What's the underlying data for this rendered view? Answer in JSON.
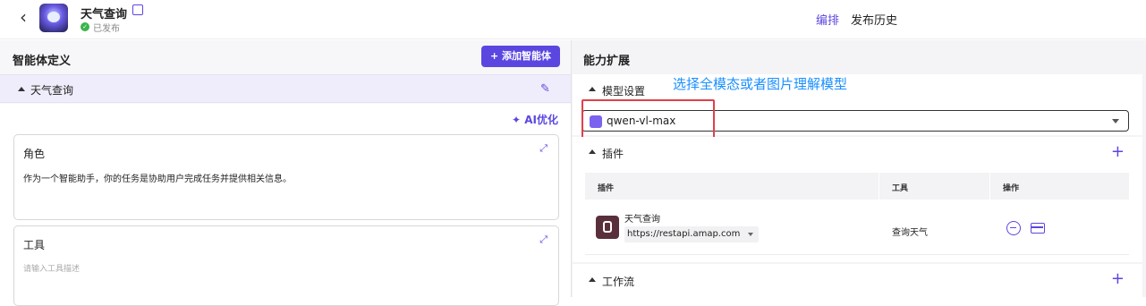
{
  "header": {
    "title": "天气查询",
    "status": "已发布",
    "nav": {
      "edit": "编排",
      "history": "发布历史"
    }
  },
  "left": {
    "title": "智能体定义",
    "add_button": "添加智能体",
    "agent_name": "天气查询",
    "ai_optimize": "AI优化",
    "role": {
      "title": "角色",
      "text": "作为一个智能助手，你的任务是协助用户完成任务并提供相关信息。"
    },
    "tool": {
      "title": "工具",
      "placeholder": "请输入工具描述"
    }
  },
  "right": {
    "title": "能力扩展",
    "model": {
      "title": "模型设置",
      "value": "qwen-vl-max",
      "annotation": "选择全模态或者图片理解模型"
    },
    "plugins": {
      "title": "插件",
      "columns": [
        "插件",
        "工具",
        "操作"
      ],
      "rows": [
        {
          "name": "天气查询",
          "url": "https://restapi.amap.com",
          "tool": "查询天气"
        }
      ]
    },
    "workflow": {
      "title": "工作流"
    }
  },
  "colors": {
    "accent": "#5b47e0",
    "annotation_box": "#e0404a",
    "annotation_text": "#1a8fff"
  },
  "icons": [
    "back-icon",
    "app-avatar",
    "edit-icon",
    "published-check-icon",
    "pencil-icon",
    "ai-sparkle-icon",
    "expand-icon",
    "model-icon",
    "dropdown-icon",
    "plus-icon",
    "remove-icon",
    "card-icon"
  ]
}
